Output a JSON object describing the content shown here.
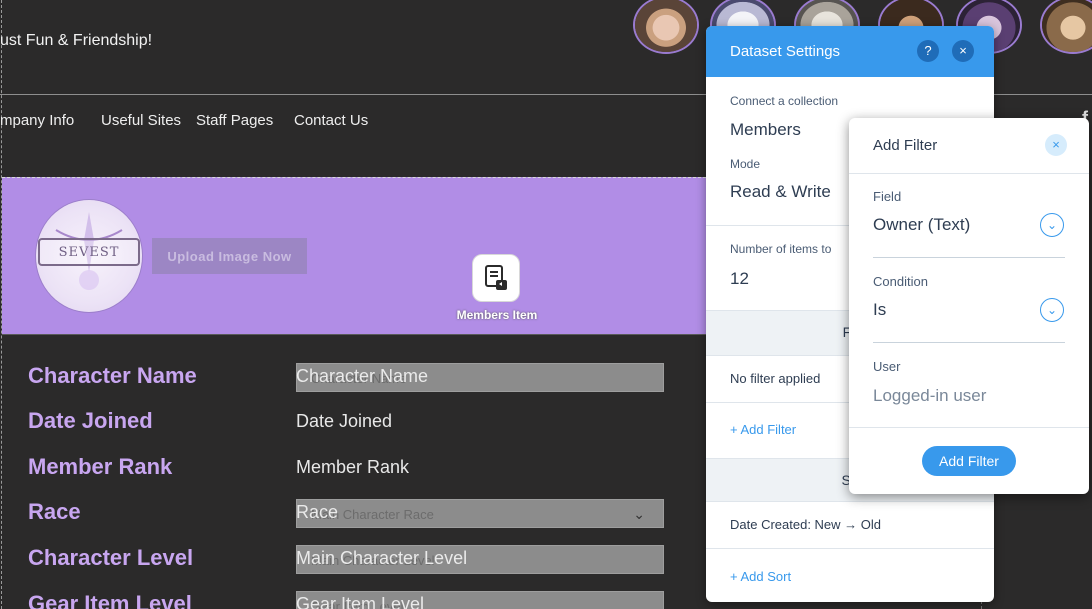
{
  "site": {
    "tagline": "ust Fun & Friendship!",
    "nav": [
      "mpany Info",
      "Useful Sites",
      "Staff Pages",
      "Contact Us"
    ]
  },
  "banner": {
    "logo_text": "SEVEST",
    "upload_label": "Upload Image Now",
    "item_label": "Members Item"
  },
  "form": {
    "rows": [
      {
        "label": "Character Name",
        "value": "Character Name",
        "placeholder": "Character Name"
      },
      {
        "label": "Date Joined",
        "value": "Date Joined"
      },
      {
        "label": "Member Rank",
        "value": "Member Rank"
      },
      {
        "label": "Race",
        "value": "Race",
        "placeholder": "Main Character Race"
      },
      {
        "label": "Character Level",
        "value": "Main Character Level",
        "placeholder": "Main Character Level"
      },
      {
        "label": "Gear Item Level",
        "value": "Gear Item Level",
        "placeholder": "Gear Item Level"
      }
    ]
  },
  "dataset_panel": {
    "title": "Dataset Settings",
    "help": "?",
    "close": "×",
    "collection_label": "Connect a collection",
    "collection_value": "Members",
    "mode_label": "Mode",
    "mode_value": "Read & Write",
    "items_label": "Number of items to",
    "items_value": "12",
    "filter_header": "Fil",
    "no_filter": "No filter applied",
    "add_filter_link": "+ Add Filter",
    "sort_header": "So",
    "sort_value": "Date Created: New → Old",
    "add_sort_link": "+ Add Sort"
  },
  "add_filter_popup": {
    "title": "Add Filter",
    "close": "×",
    "field_label": "Field",
    "field_value": "Owner (Text)",
    "condition_label": "Condition",
    "condition_value": "Is",
    "user_label": "User",
    "user_value": "Logged-in user",
    "chevron": "⌄",
    "button": "Add Filter"
  },
  "edge_letter": "f",
  "colors": {
    "background": "#2b2a2a",
    "banner": "#b18de6",
    "label_purple": "#c8a6f0",
    "wix_blue": "#3899ec"
  }
}
